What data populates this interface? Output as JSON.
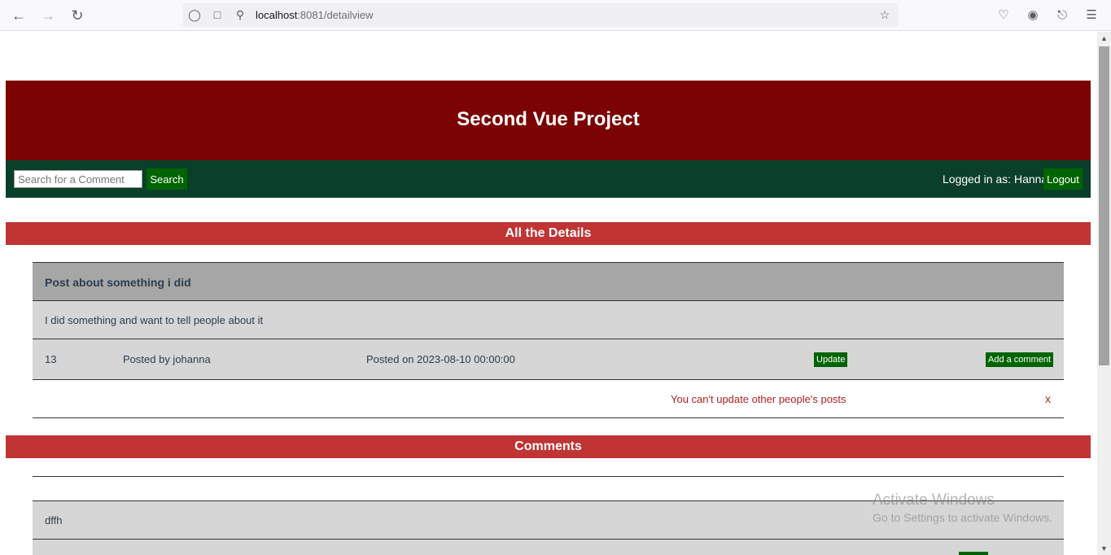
{
  "browser": {
    "url_host": "localhost",
    "url_rest": ":8081/detailview"
  },
  "header": {
    "title": "Second Vue Project"
  },
  "navbar": {
    "search_placeholder": "Search for a Comment",
    "search_label": "Search",
    "logged_in_text": "Logged in as: Hanna",
    "logout_label": "Logout"
  },
  "details": {
    "section_title": "All the Details",
    "post_title": "Post about something i did",
    "post_body": "I did something and want to tell people about it",
    "post_id": "13",
    "posted_by": "Posted by johanna",
    "posted_on": "Posted on 2023-08-10 00:00:00",
    "update_label": "Update",
    "add_comment_label": "Add a comment",
    "error_message": "You can't update other people's posts",
    "close_label": "x"
  },
  "comments": {
    "section_title": "Comments",
    "items": [
      {
        "text": "dffh"
      }
    ]
  },
  "watermark": {
    "line1": "Activate Windows",
    "line2": "Go to Settings to activate Windows."
  }
}
